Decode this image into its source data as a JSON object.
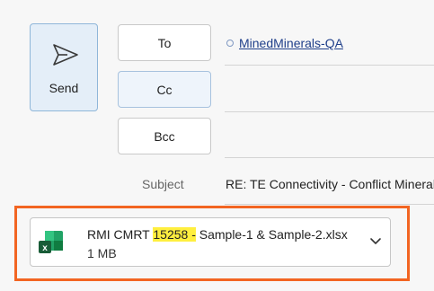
{
  "send": {
    "label": "Send",
    "icon": "send-icon"
  },
  "recipients": {
    "to_label": "To",
    "cc_label": "Cc",
    "bcc_label": "Bcc",
    "to_value": "MinedMinerals-QA"
  },
  "subject": {
    "label": "Subject",
    "value": "RE: TE Connectivity - Conflict Mineral"
  },
  "attachment": {
    "name_prefix": "RMI CMRT ",
    "name_highlight": "15258 -",
    "name_suffix": " Sample-1 & Sample-2.xlsx",
    "size": "1 MB",
    "icon": "excel-icon"
  },
  "colors": {
    "highlight_frame": "#f26522",
    "text_highlight": "#ffef3f",
    "send_bg": "#e4eef8"
  }
}
